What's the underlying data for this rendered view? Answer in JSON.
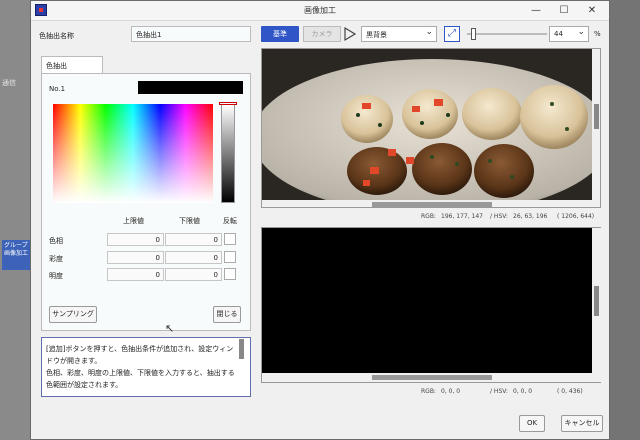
{
  "background_app": {
    "labels": [
      "通信",
      "グループ",
      "画像加工"
    ]
  },
  "dialog": {
    "title": "画像加工",
    "minimize_glyph": "—",
    "maximize_glyph": "☐",
    "close_glyph": "✕"
  },
  "left_panel": {
    "name_label": "色抽出名称",
    "name_value": "色抽出1",
    "tab_label": "色抽出",
    "no_label": "No.1",
    "swatch_color": "#000000",
    "headers": {
      "upper": "上限値",
      "lower": "下限値",
      "invert": "反転"
    },
    "rows": [
      {
        "label": "色相",
        "upper": "0",
        "lower": "0"
      },
      {
        "label": "彩度",
        "upper": "0",
        "lower": "0"
      },
      {
        "label": "明度",
        "upper": "0",
        "lower": "0"
      }
    ],
    "sampling_button": "サンプリング",
    "close_button": "閉じる",
    "help_text": [
      "[追加]ボタンを押すと、色抽出条件が追加され、設定ウィンドウが開きます。",
      "色相、彩度、明度の上限値、下限値を入力すると、抽出する色範囲が設定されます。"
    ]
  },
  "right_panel": {
    "kijun_button": "基準",
    "camera_button": "カメラ",
    "background_select": "黒背景",
    "zoom_value": "44",
    "zoom_unit": "%",
    "slider_value_fraction": 0.08,
    "status_top": {
      "rgb_label": "RGB:",
      "rgb_value": "196,   177,   147",
      "hsv_label": "/ HSV:",
      "hsv_value": "26,   63,   196",
      "coord": "(   1206,   644)"
    },
    "status_bottom": {
      "rgb_label": "RGB:",
      "rgb_value": "0,   0,   0",
      "hsv_label": "/ HSV:",
      "hsv_value": "0,   0,   0",
      "coord": "(   0,   436)"
    }
  },
  "footer": {
    "ok_button": "OK",
    "cancel_button": "キャンセル"
  },
  "colors": {
    "accent": "#2f55c6",
    "help_border": "#5f6fae"
  }
}
